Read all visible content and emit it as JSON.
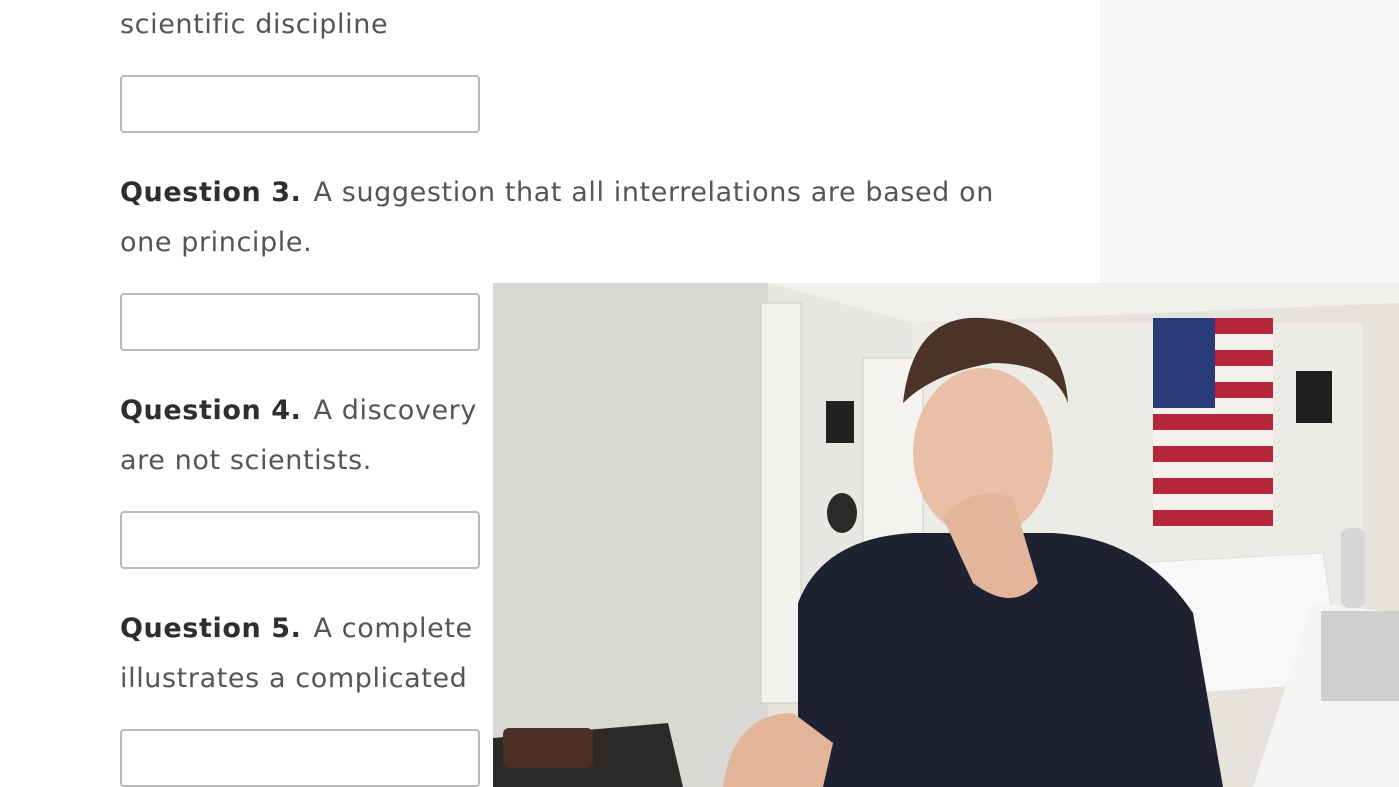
{
  "quiz": {
    "prev_question_tail": "scientific discipline",
    "questions": [
      {
        "label": "Question 3.",
        "line1": "A suggestion that all interrelations are based on",
        "line2": "one principle."
      },
      {
        "label": "Question 4.",
        "line1": "A discovery",
        "line2": "are not scientists."
      },
      {
        "label": "Question 5.",
        "line1": "A complete",
        "line2": "illustrates a complicated"
      }
    ],
    "answers": [
      "",
      "",
      "",
      ""
    ]
  },
  "colors": {
    "page_bg": "#ffffff",
    "gutter_bg": "#f7f7f8",
    "input_border": "#b9b9b9",
    "question_label": "#2e2e2e",
    "body_text": "#555555"
  },
  "webcam": {
    "description_icon": "webcam-overlay"
  }
}
